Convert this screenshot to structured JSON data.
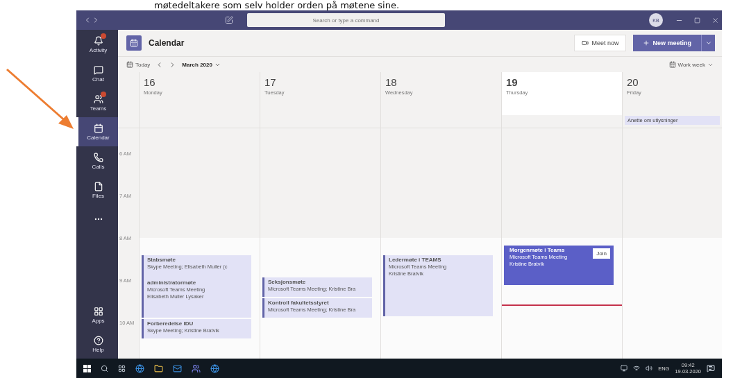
{
  "caption": "møtedeltakere som selv holder orden på møtene sine.",
  "titlebar": {
    "search_placeholder": "Search or type a command",
    "avatar": "KB"
  },
  "rail": [
    {
      "label": "Activity",
      "badge": true,
      "selected": false
    },
    {
      "label": "Chat",
      "badge": false,
      "selected": false
    },
    {
      "label": "Teams",
      "badge": true,
      "selected": false
    },
    {
      "label": "Calendar",
      "badge": false,
      "selected": true
    },
    {
      "label": "Calls",
      "badge": false,
      "selected": false
    },
    {
      "label": "Files",
      "badge": false,
      "selected": false
    },
    {
      "kind": "more",
      "badge": false,
      "selected": false
    },
    {
      "label": "Apps",
      "badge": false,
      "selected": false,
      "kind": "bottom"
    },
    {
      "label": "Help",
      "badge": false,
      "selected": false
    }
  ],
  "header": {
    "title": "Calendar",
    "meet_now": "Meet now",
    "new_meeting": "New meeting"
  },
  "toolbar": {
    "today": "Today",
    "month": "March 2020",
    "view": "Work week"
  },
  "hours": [
    "6 AM",
    "7 AM",
    "8 AM",
    "9 AM",
    "10 AM"
  ],
  "days": [
    {
      "date": "16",
      "weekday": "Monday",
      "selected": false,
      "events": [
        {
          "title": "Stabsmøte",
          "lines": [
            "Skype Meeting; Elisabeth Muller (c"
          ],
          "active": false
        },
        {
          "title": "administratormøte",
          "lines": [
            "Microsoft Teams Meeting",
            "Elisabeth Muller Lysaker"
          ],
          "active": false
        },
        {
          "title": "Forberedelse IDU",
          "lines": [
            "Skype Meeting; Kristine Bratvik"
          ],
          "active": false
        }
      ]
    },
    {
      "date": "17",
      "weekday": "Tuesday",
      "selected": false,
      "events": [
        {
          "title": "Seksjonsmøte",
          "lines": [
            "Microsoft Teams Meeting; Kristine Bra"
          ],
          "active": false
        },
        {
          "title": "Kontroll fakultetsstyret",
          "lines": [
            "Microsoft Teams Meeting; Kristine Bra"
          ],
          "active": false
        }
      ]
    },
    {
      "date": "18",
      "weekday": "Wednesday",
      "selected": false,
      "events": [
        {
          "title": "Ledermøte i TEAMS",
          "lines": [
            "Microsoft Teams Meeting",
            "Kristine Bratvik"
          ],
          "active": false
        }
      ]
    },
    {
      "date": "19",
      "weekday": "Thursday",
      "selected": true,
      "events": [
        {
          "title": "Morgenmøte i Teams",
          "lines": [
            "Microsoft Teams Meeting",
            "Kristine Bratvik"
          ],
          "active": true,
          "join": "Join"
        }
      ]
    },
    {
      "date": "20",
      "weekday": "Friday",
      "selected": false,
      "all_day": [
        "Anette om utlysninger"
      ]
    }
  ],
  "taskbar": {
    "language": "ENG",
    "time": "09:42",
    "date": "19.03.2020"
  }
}
